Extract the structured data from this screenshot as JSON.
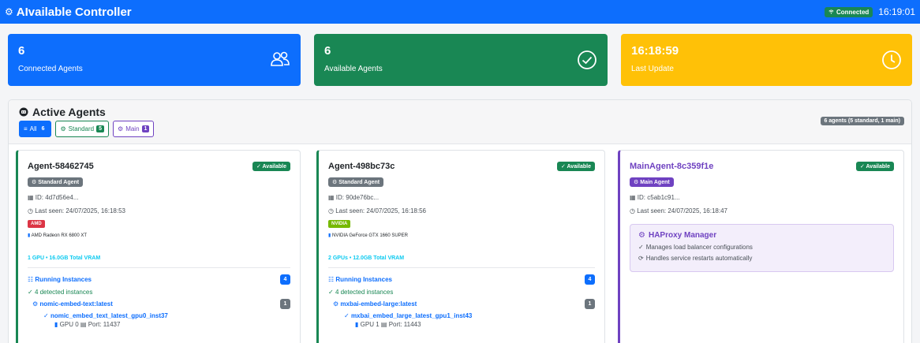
{
  "app": {
    "brand_icon": "⚙",
    "title": "AIvailable Controller",
    "connection_status": "Connected",
    "clock": "16:19:01"
  },
  "stats": [
    {
      "value": "6",
      "label": "Connected Agents",
      "icon": "users-icon",
      "color": "#0d6efd"
    },
    {
      "value": "6",
      "label": "Available Agents",
      "icon": "check-circle-icon",
      "color": "#198754"
    },
    {
      "value": "16:18:59",
      "label": "Last Update",
      "icon": "clock-icon",
      "color": "#ffc107"
    }
  ],
  "panel": {
    "title": "Active Agents",
    "summary": "6 agents (5 standard, 1 main)",
    "filters": [
      {
        "label": "All",
        "count": "6"
      },
      {
        "label": "Standard",
        "count": "5"
      },
      {
        "label": "Main",
        "count": "1"
      }
    ]
  },
  "agents": [
    {
      "name": "Agent-58462745",
      "status": "Available",
      "type": "Standard Agent",
      "id": "ID: 4d7d56e4...",
      "last_seen": "Last seen: 24/07/2025, 16:18:53",
      "vendor": "AMD",
      "gpu_model": "AMD Radeon RX 6800 XT",
      "vram": "1 GPU • 16.0GB Total VRAM",
      "running_label": "Running Instances",
      "running_count": "4",
      "detected": "4 detected instances",
      "model": "nomic-embed-text:latest",
      "model_count": "1",
      "instance": "nomic_embed_text_latest_gpu0_inst37",
      "gpu": "GPU 0",
      "port": "Port: 11437"
    },
    {
      "name": "Agent-498bc73c",
      "status": "Available",
      "type": "Standard Agent",
      "id": "ID: 90de76bc...",
      "last_seen": "Last seen: 24/07/2025, 16:18:56",
      "vendor": "NVIDIA",
      "gpu_model": "NVIDIA GeForce GTX 1660 SUPER",
      "vram": "2 GPUs • 12.0GB Total VRAM",
      "running_label": "Running Instances",
      "running_count": "4",
      "detected": "4 detected instances",
      "model": "mxbai-embed-large:latest",
      "model_count": "1",
      "instance": "mxbai_embed_large_latest_gpu1_inst43",
      "gpu": "GPU 1",
      "port": "Port: 11443"
    },
    {
      "name": "MainAgent-8c359f1e",
      "status": "Available",
      "type": "Main Agent",
      "id": "ID: c5ab1c91...",
      "last_seen": "Last seen: 24/07/2025, 16:18:47",
      "haproxy_title": "HAProxy Manager",
      "haproxy_lines": [
        "Manages load balancer configurations",
        "Handles service restarts automatically"
      ]
    }
  ]
}
